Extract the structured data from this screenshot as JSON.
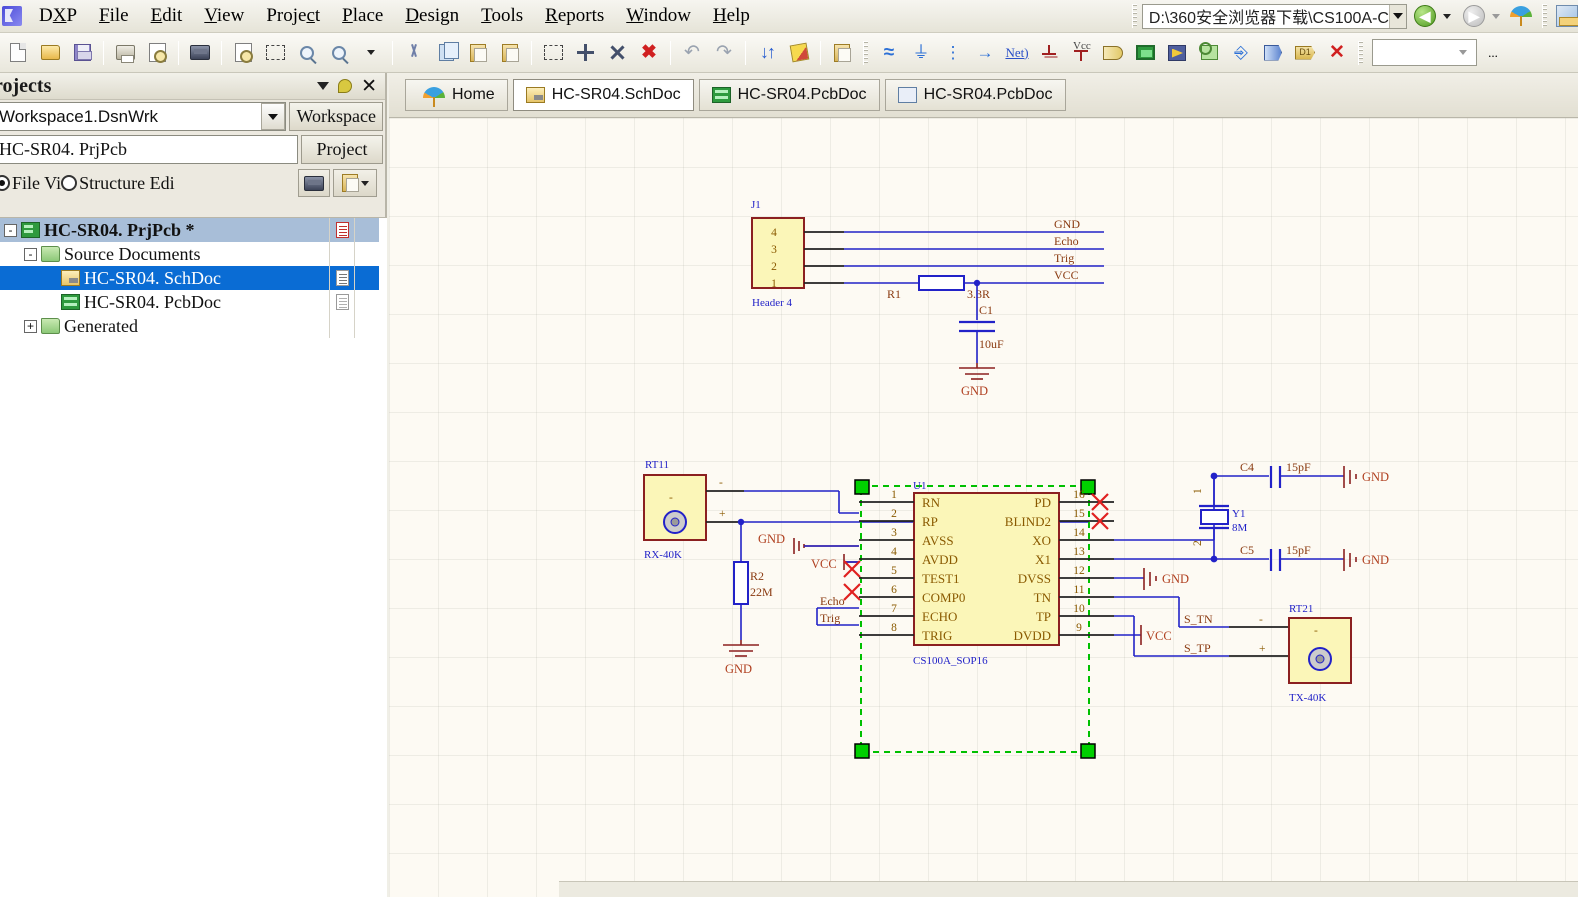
{
  "app": {
    "logo": "altium-logo",
    "menus": [
      {
        "label": "DXP",
        "accel": "X"
      },
      {
        "label": "File",
        "accel": "F"
      },
      {
        "label": "Edit",
        "accel": "E"
      },
      {
        "label": "View",
        "accel": "V"
      },
      {
        "label": "Project",
        "accel": "c"
      },
      {
        "label": "Place",
        "accel": "P"
      },
      {
        "label": "Design",
        "accel": "D"
      },
      {
        "label": "Tools",
        "accel": "T"
      },
      {
        "label": "Reports",
        "accel": "R"
      },
      {
        "label": "Window",
        "accel": "W"
      },
      {
        "label": "Help",
        "accel": "H"
      }
    ],
    "path_value": "D:\\360安全浏览器下载\\CS100A-C",
    "nav_back_icon": "back-arrow-icon",
    "nav_forward_icon": "forward-arrow-icon",
    "home_umbrella_icon": "altium-umbrella-icon",
    "ruler_icon": "ruler-icon"
  },
  "toolbar": {
    "items": [
      {
        "name": "new-document",
        "icon": "page-icon"
      },
      {
        "name": "open-document",
        "icon": "folder-open-icon"
      },
      {
        "name": "save-document",
        "icon": "floppy-save-icon"
      },
      {
        "sep": true
      },
      {
        "name": "print",
        "icon": "printer-icon"
      },
      {
        "name": "print-preview",
        "icon": "print-preview-icon"
      },
      {
        "sep": true
      },
      {
        "name": "open-pcb-board",
        "icon": "pcb-board-icon"
      },
      {
        "sep": true
      },
      {
        "name": "zoom-document",
        "icon": "zoom-document-icon"
      },
      {
        "name": "zoom-area",
        "icon": "zoom-area-icon"
      },
      {
        "name": "zoom-in",
        "icon": "zoom-in-icon"
      },
      {
        "name": "zoom-selected",
        "icon": "zoom-selected-icon"
      },
      {
        "name": "zoom-dropdown",
        "icon": "chevron-down-icon"
      },
      {
        "sep": true
      },
      {
        "name": "cut",
        "icon": "scissors-icon"
      },
      {
        "name": "copy",
        "icon": "copy-icon"
      },
      {
        "name": "paste",
        "icon": "paste-icon"
      },
      {
        "name": "paste-special",
        "icon": "paste-special-icon"
      },
      {
        "sep": true
      },
      {
        "name": "select-area",
        "icon": "dashed-rectangle-icon"
      },
      {
        "name": "move-selection",
        "icon": "move-cross-icon"
      },
      {
        "name": "align",
        "icon": "align-icon"
      },
      {
        "name": "clear-selection",
        "icon": "clear-filter-icon"
      },
      {
        "sep": true
      },
      {
        "name": "undo",
        "icon": "undo-arrow-icon"
      },
      {
        "name": "redo",
        "icon": "redo-arrow-icon"
      },
      {
        "sep": true
      },
      {
        "name": "update-from-pcb",
        "icon": "up-down-arrows-icon"
      },
      {
        "name": "annotate",
        "icon": "pencil-icon"
      },
      {
        "sep": true
      },
      {
        "name": "browse-library",
        "icon": "library-browse-icon"
      },
      {
        "grip": true
      },
      {
        "name": "place-wire",
        "icon": "wire-icon"
      },
      {
        "name": "place-bus",
        "icon": "bus-icon"
      },
      {
        "name": "place-bus-entry",
        "icon": "bus-entry-icon"
      },
      {
        "name": "place-signal-harness",
        "icon": "harness-icon"
      },
      {
        "name": "place-net-label",
        "icon": "net-label-icon",
        "text": "Net)"
      },
      {
        "name": "place-gnd-power-port",
        "icon": "gnd-power-port-icon"
      },
      {
        "name": "place-vcc-power-port",
        "icon": "vcc-power-port-icon",
        "text": "Vcc"
      },
      {
        "name": "place-part",
        "icon": "logic-gate-icon"
      },
      {
        "name": "place-sheet-symbol",
        "icon": "sheet-symbol-icon"
      },
      {
        "name": "place-sheet-entry",
        "icon": "sheet-entry-icon"
      },
      {
        "name": "place-device-sheet",
        "icon": "device-sheet-icon"
      },
      {
        "name": "place-harness-connector",
        "icon": "harness-connector-icon"
      },
      {
        "name": "place-port",
        "icon": "port-icon"
      },
      {
        "name": "place-offsheet-connector",
        "icon": "offsheet-connector-icon",
        "text": "D1"
      },
      {
        "name": "place-no-erc",
        "icon": "no-erc-cross-icon"
      },
      {
        "grip": true
      },
      {
        "name": "toolbar-combo",
        "icon": "combo-box"
      },
      {
        "name": "toolbar-overflow",
        "text": "..."
      }
    ]
  },
  "panel": {
    "title": "rojects",
    "header_icons": [
      "chevron-down-icon",
      "pin-icon",
      "close-icon"
    ],
    "workspace_value": "Workspace1.DsnWrk",
    "workspace_button": "Workspace",
    "project_value": "HC-SR04. PrjPcb",
    "project_button": "Project",
    "view_modes": [
      {
        "label": "File Vi",
        "selected": true
      },
      {
        "label": "Structure Edi",
        "selected": false
      }
    ],
    "side_buttons": [
      "open-board-icon",
      "document-options-icon"
    ],
    "tree": [
      {
        "indent": 0,
        "expander": "-",
        "icon": "prjpcb-icon",
        "label": "HC-SR04. PrjPcb  *",
        "bold": true,
        "selected": "project",
        "doc_icon": "red"
      },
      {
        "indent": 1,
        "expander": "-",
        "icon": "folder-green-icon",
        "label": "Source Documents",
        "bold": false,
        "selected": "",
        "doc_icon": ""
      },
      {
        "indent": 2,
        "expander": "",
        "icon": "schdoc-icon",
        "label": "HC-SR04. SchDoc",
        "bold": false,
        "selected": "doc",
        "doc_icon": "dark"
      },
      {
        "indent": 2,
        "expander": "",
        "icon": "pcbdoc-icon",
        "label": "HC-SR04. PcbDoc",
        "bold": false,
        "selected": "",
        "doc_icon": "gray"
      },
      {
        "indent": 1,
        "expander": "+",
        "icon": "folder-green-icon",
        "label": "Generated",
        "bold": false,
        "selected": "",
        "doc_icon": ""
      }
    ]
  },
  "tabs": [
    {
      "label": "Home",
      "icon": "umbrella-icon",
      "active": false
    },
    {
      "label": "HC-SR04.SchDoc",
      "icon": "schdoc-icon",
      "active": true
    },
    {
      "label": "HC-SR04.PcbDoc",
      "icon": "pcbdoc-icon",
      "active": false
    },
    {
      "label": "HC-SR04.PcbDoc",
      "icon": "pcb3d-icon",
      "active": false
    }
  ],
  "schematic": {
    "colors": {
      "wire": "#2222c8",
      "pin": "#222222",
      "body_fill": "#fbf6b8",
      "body_border": "#8b2020",
      "text_designator": "#2222c8",
      "text_pin": "#8a5a00",
      "net_label": "#8a3a10",
      "power_red": "#8b2020",
      "no_erc": "#e02020",
      "compile_mask": "#00c000",
      "canvas_bg": "#fdfaf3"
    },
    "components": [
      {
        "designator": "J1",
        "comment": "Header 4",
        "pins": [
          "4",
          "3",
          "2",
          "1"
        ]
      },
      {
        "designator": "R1",
        "value": "3.3R"
      },
      {
        "designator": "C1",
        "value": "10uF"
      },
      {
        "designator": "RT11",
        "comment": "RX-40K",
        "terminals": [
          "-",
          "+"
        ]
      },
      {
        "designator": "R2",
        "value": "22M"
      },
      {
        "designator": "U1",
        "comment": "CS100A_SOP16"
      },
      {
        "designator": "Y1",
        "value": "8M",
        "pins": [
          "1",
          "2"
        ]
      },
      {
        "designator": "C4",
        "value": "15pF"
      },
      {
        "designator": "C5",
        "value": "15pF"
      },
      {
        "designator": "RT21",
        "comment": "TX-40K",
        "terminals": [
          "-",
          "+"
        ]
      }
    ],
    "u1": {
      "designator": "U1",
      "comment": "CS100A_SOP16",
      "left_pins": [
        {
          "num": "1",
          "name": "RN"
        },
        {
          "num": "2",
          "name": "RP"
        },
        {
          "num": "3",
          "name": "AVSS"
        },
        {
          "num": "4",
          "name": "AVDD"
        },
        {
          "num": "5",
          "name": "TEST1"
        },
        {
          "num": "6",
          "name": "COMP0"
        },
        {
          "num": "7",
          "name": "ECHO"
        },
        {
          "num": "8",
          "name": "TRIG"
        }
      ],
      "right_pins": [
        {
          "num": "16",
          "name": "PD"
        },
        {
          "num": "15",
          "name": "BLIND2"
        },
        {
          "num": "14",
          "name": "XO"
        },
        {
          "num": "13",
          "name": "X1"
        },
        {
          "num": "12",
          "name": "DVSS"
        },
        {
          "num": "11",
          "name": "TN"
        },
        {
          "num": "10",
          "name": "TP"
        },
        {
          "num": "9",
          "name": "DVDD"
        }
      ]
    },
    "net_labels": [
      "GND",
      "Echo",
      "Trig",
      "VCC",
      "S_TN",
      "S_TP"
    ],
    "power_ports": [
      {
        "type": "GND",
        "label": "GND"
      },
      {
        "type": "GND",
        "label": "GND"
      },
      {
        "type": "GND",
        "label": "GND"
      },
      {
        "type": "GND",
        "label": "GND"
      },
      {
        "type": "GND",
        "label": "GND"
      },
      {
        "type": "VCC",
        "label": "VCC"
      },
      {
        "type": "VCC",
        "label": "VCC"
      }
    ]
  }
}
